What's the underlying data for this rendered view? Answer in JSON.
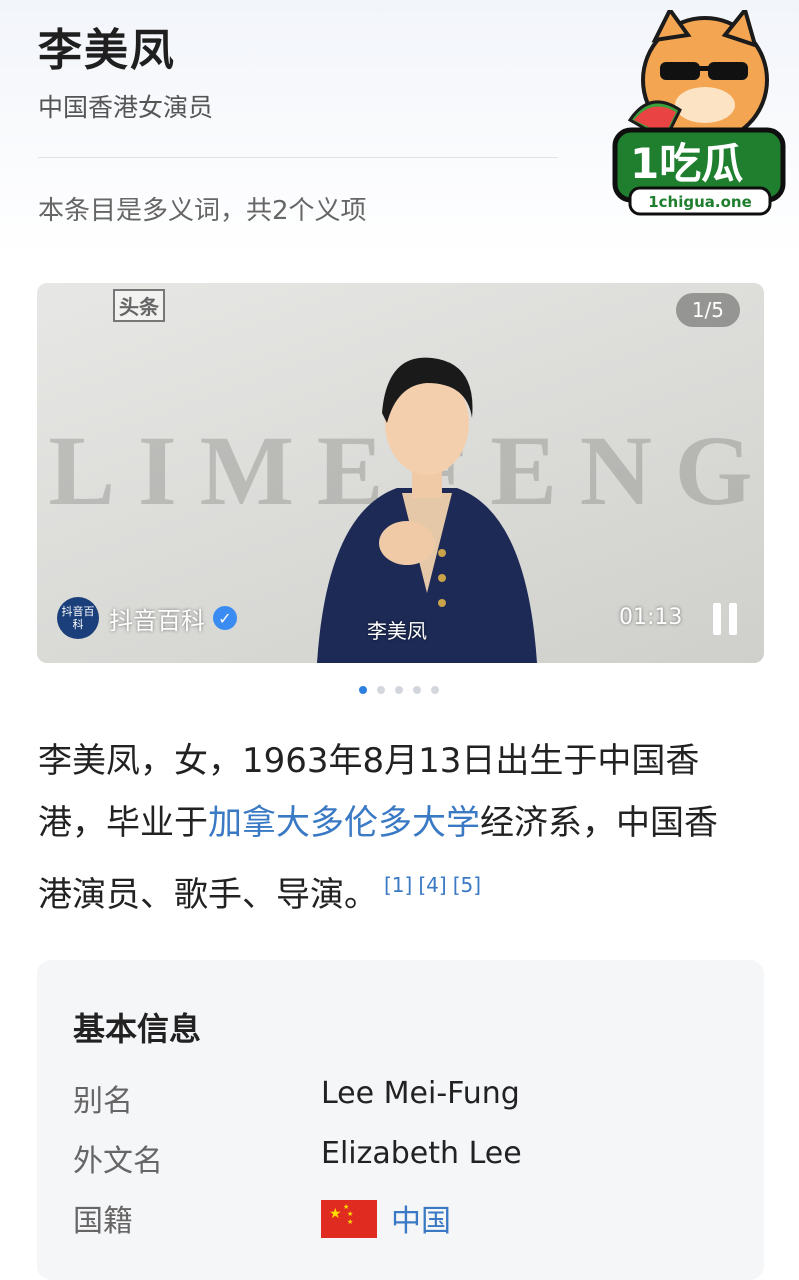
{
  "header": {
    "title": "李美凤",
    "subtitle": "中国香港女演员",
    "polysemy_note": "本条目是多义词，共2个义项"
  },
  "watermark": {
    "brand": "1吃瓜",
    "site": "1chigua.one"
  },
  "video": {
    "corner_tag": "头条",
    "counter": "1/5",
    "background_letters": [
      "L",
      "I",
      "M",
      "E",
      "F",
      "E",
      "N",
      "G"
    ],
    "caption": "李美凤",
    "source_badge": "抖音百科",
    "source_name": "抖音百科",
    "time": "01:13",
    "active_slide": 1,
    "slides_total": 5
  },
  "summary": {
    "text_before": "李美凤，女，1963年8月13日出生于中国香港，毕业于",
    "link_text": "加拿大多伦多大学",
    "text_after": "经济系，中国香港演员、歌手、导演。",
    "citations": [
      "[1]",
      "[4]",
      "[5]"
    ]
  },
  "basic_info": {
    "title": "基本信息",
    "rows": [
      {
        "key": "别名",
        "value": "Lee Mei-Fung"
      },
      {
        "key": "外文名",
        "value": "Elizabeth Lee"
      },
      {
        "key": "国籍",
        "value": "中国"
      }
    ]
  },
  "colors": {
    "link": "#3a79c4",
    "dot_active": "#2d7fe0",
    "verify": "#3b8cf2",
    "flag_red": "#e02b20"
  }
}
